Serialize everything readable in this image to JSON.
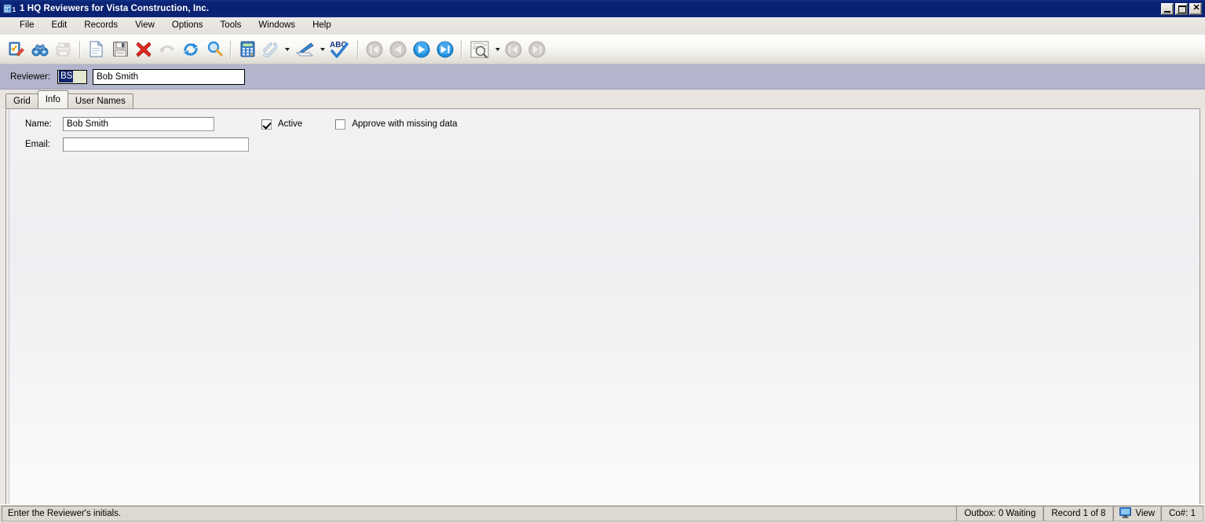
{
  "window": {
    "title": "1 HQ Reviewers for Vista Construction, Inc.",
    "icon": "document-record-icon",
    "controls": {
      "minimize": "_",
      "maximize": "❐",
      "close": "✕"
    }
  },
  "menu": {
    "items": [
      {
        "label": "File"
      },
      {
        "label": "Edit"
      },
      {
        "label": "Records"
      },
      {
        "label": "View"
      },
      {
        "label": "Options"
      },
      {
        "label": "Tools"
      },
      {
        "label": "Windows"
      },
      {
        "label": "Help"
      }
    ]
  },
  "toolbar": {
    "buttons": [
      {
        "name": "edit-record-icon",
        "enabled": true
      },
      {
        "name": "binoculars-find-icon",
        "enabled": true
      },
      {
        "name": "print-grid-icon",
        "enabled": false
      },
      {
        "name": "new-record-icon",
        "enabled": true
      },
      {
        "name": "save-icon",
        "enabled": true
      },
      {
        "name": "delete-record-icon",
        "enabled": true
      },
      {
        "name": "undo-icon",
        "enabled": false
      },
      {
        "name": "refresh-icon",
        "enabled": true
      },
      {
        "name": "search-icon",
        "enabled": true
      },
      {
        "name": "calculator-icon",
        "enabled": true
      },
      {
        "name": "attachment-paperclip-icon",
        "enabled": true,
        "dropdown": true
      },
      {
        "name": "scanner-icon",
        "enabled": true,
        "dropdown": true
      },
      {
        "name": "spell-check-icon",
        "enabled": true
      },
      {
        "name": "first-record-icon",
        "enabled": false
      },
      {
        "name": "previous-record-icon",
        "enabled": false
      },
      {
        "name": "next-record-icon",
        "enabled": true
      },
      {
        "name": "last-record-icon",
        "enabled": true
      },
      {
        "name": "print-preview-icon",
        "enabled": true,
        "dropdown": true
      },
      {
        "name": "previous-page-icon",
        "enabled": false
      },
      {
        "name": "next-page-icon",
        "enabled": false
      }
    ]
  },
  "reviewer_band": {
    "label": "Reviewer:",
    "code_value": "BS",
    "code_selected": true,
    "name_value": "Bob Smith"
  },
  "tabs": [
    {
      "label": "Grid",
      "active": false
    },
    {
      "label": "Info",
      "active": true
    },
    {
      "label": "User Names",
      "active": false
    }
  ],
  "form": {
    "name_label": "Name:",
    "name_value": "Bob Smith",
    "email_label": "Email:",
    "email_value": "",
    "email_placeholder": "",
    "active_label": "Active",
    "active_checked": true,
    "approve_label": "Approve with missing data",
    "approve_checked": false
  },
  "statusbar": {
    "hint": "Enter the Reviewer's initials.",
    "outbox": "Outbox: 0 Waiting",
    "record": "Record 1 of 8",
    "view": "View",
    "view_icon": "monitor-icon",
    "company": "Co#: 1"
  },
  "colors": {
    "titlebar": "#0a2070",
    "reviewer_band": "#b3b5cd",
    "selection": "#10246e",
    "accent_blue": "#2196e8",
    "delete_red": "#e02a20"
  }
}
